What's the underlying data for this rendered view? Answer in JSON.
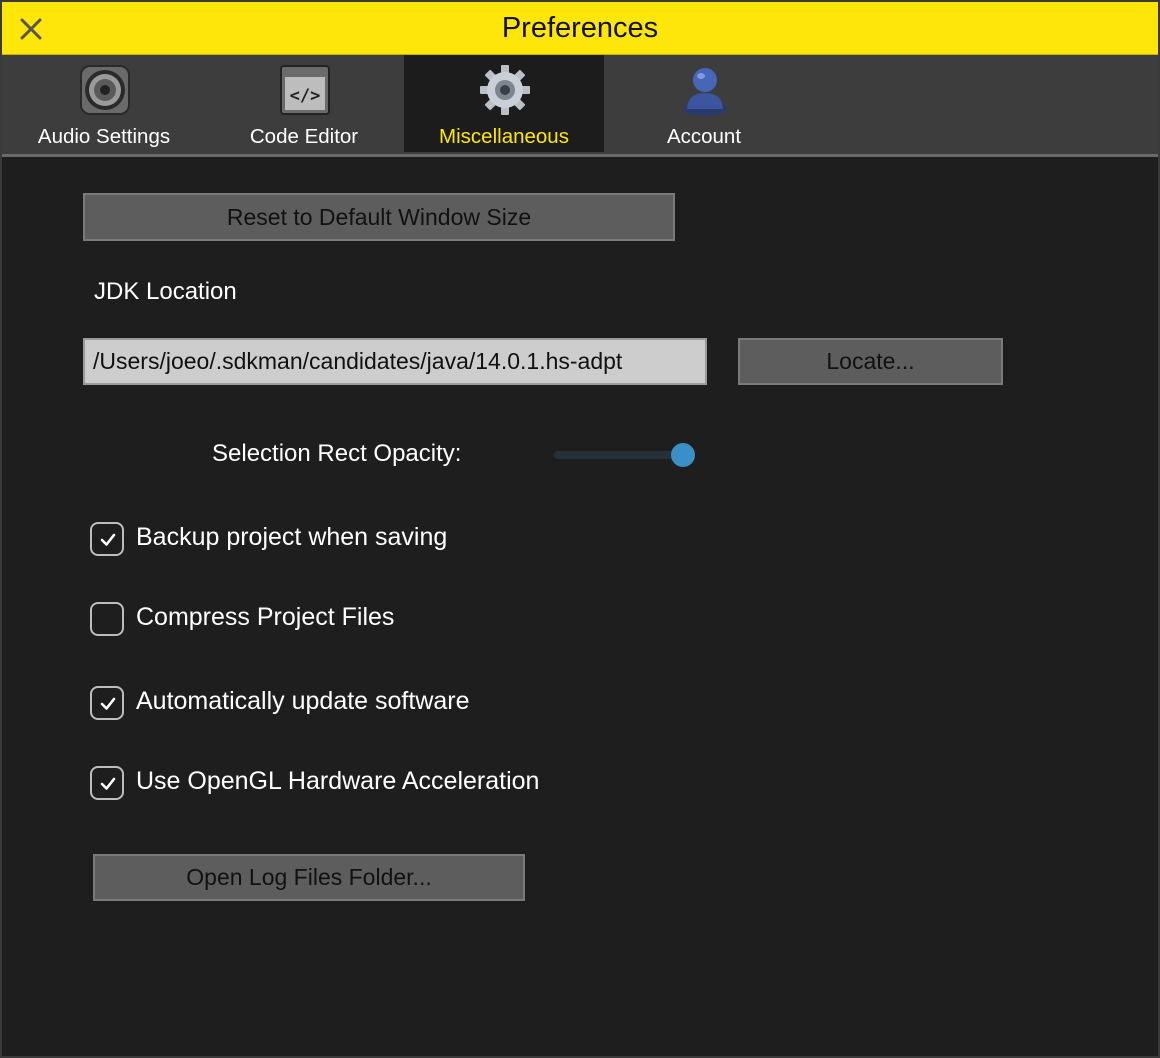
{
  "window": {
    "title": "Preferences",
    "accent_color": "#ffe60a",
    "close_icon": "close-icon"
  },
  "tabs": [
    {
      "label": "Audio Settings",
      "icon": "speaker-icon",
      "active": false
    },
    {
      "label": "Code Editor",
      "icon": "code-icon",
      "active": false
    },
    {
      "label": "Miscellaneous",
      "icon": "gear-icon",
      "active": true
    },
    {
      "label": "Account",
      "icon": "user-icon",
      "active": false
    }
  ],
  "misc": {
    "reset_button_label": "Reset to Default Window Size",
    "jdk_label": "JDK Location",
    "jdk_path": "/Users/joeo/.sdkman/candidates/java/14.0.1.hs-adpt",
    "locate_button_label": "Locate...",
    "opacity_label": "Selection Rect Opacity:",
    "opacity_value": 0.92,
    "slider_color": "#3a8fc7",
    "options": [
      {
        "label": "Backup project when saving",
        "checked": true
      },
      {
        "label": "Compress Project Files",
        "checked": false
      },
      {
        "label": "Automatically update software",
        "checked": true
      },
      {
        "label": "Use OpenGL Hardware Acceleration",
        "checked": true
      }
    ],
    "log_button_label": "Open Log Files Folder..."
  }
}
